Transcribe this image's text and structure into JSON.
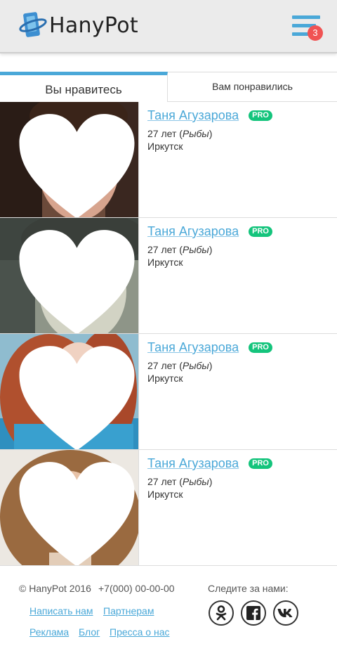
{
  "header": {
    "logo_text": "HanyPot",
    "menu_badge": "3"
  },
  "tabs": [
    {
      "label": "Вы нравитесь",
      "active": true
    },
    {
      "label": "Вам понравились",
      "active": false
    }
  ],
  "cards": [
    {
      "name": "Таня Агузарова",
      "badge": "PRO",
      "age": "27 лет (",
      "sign": "Рыбы",
      "close": ")",
      "city": "Иркутск"
    },
    {
      "name": "Таня Агузарова",
      "badge": "PRO",
      "age": "27 лет (",
      "sign": "Рыбы",
      "close": ")",
      "city": "Иркутск"
    },
    {
      "name": "Таня Агузарова",
      "badge": "PRO",
      "age": "27 лет (",
      "sign": "Рыбы",
      "close": ")",
      "city": "Иркутск"
    },
    {
      "name": "Таня Агузарова",
      "badge": "PRO",
      "age": "27 лет (",
      "sign": "Рыбы",
      "close": ")",
      "city": "Иркутск"
    }
  ],
  "footer": {
    "copyright": "© HanyPot 2016",
    "phone": "+7(000) 00-00-00",
    "follow_label": "Следите за нами:",
    "links": [
      "Написать нам",
      "Партнерам",
      "Реклама",
      "Блог",
      "Пресса о нас"
    ],
    "social": [
      "odnoklassniki-icon",
      "facebook-icon",
      "vk-icon"
    ]
  },
  "colors": {
    "accent": "#4aa8d8",
    "pro_badge": "#14c47c",
    "menu_badge": "#f05353"
  }
}
